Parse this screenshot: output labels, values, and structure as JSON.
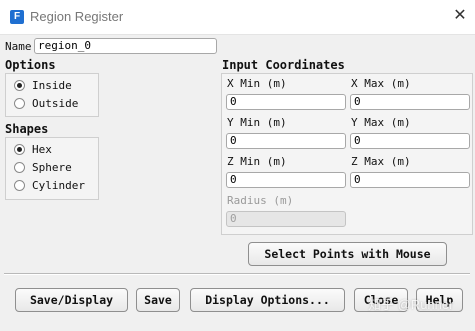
{
  "window": {
    "title": "Region Register",
    "icon_letter": "F",
    "close_glyph": "✕"
  },
  "name_field": {
    "label": "Name",
    "value": "region_0"
  },
  "options": {
    "heading": "Options",
    "items": [
      {
        "label": "Inside",
        "selected": true
      },
      {
        "label": "Outside",
        "selected": false
      }
    ]
  },
  "shapes": {
    "heading": "Shapes",
    "items": [
      {
        "label": "Hex",
        "selected": true
      },
      {
        "label": "Sphere",
        "selected": false
      },
      {
        "label": "Cylinder",
        "selected": false
      }
    ]
  },
  "input_coordinates": {
    "heading": "Input Coordinates",
    "x_min": {
      "label": "X Min (m)",
      "value": "0"
    },
    "x_max": {
      "label": "X Max (m)",
      "value": "0"
    },
    "y_min": {
      "label": "Y Min (m)",
      "value": "0"
    },
    "y_max": {
      "label": "Y Max (m)",
      "value": "0"
    },
    "z_min": {
      "label": "Z Min (m)",
      "value": "0"
    },
    "z_max": {
      "label": "Z Max (m)",
      "value": "0"
    },
    "radius": {
      "label": "Radius (m)",
      "value": "0",
      "enabled": false
    }
  },
  "select_points_button": "Select Points with Mouse",
  "footer_buttons": {
    "save_display": "Save/Display",
    "save": "Save",
    "display_options": "Display Options...",
    "close": "Close",
    "help": "Help"
  },
  "watermark": "知乎 @Runner"
}
